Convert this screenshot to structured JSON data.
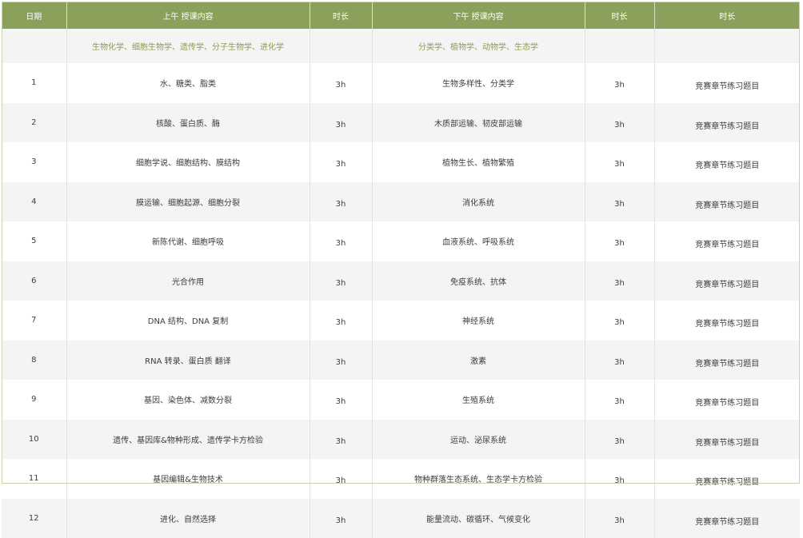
{
  "header": [
    "日期",
    "上午 授课内容",
    "时长",
    "下午 授课内容",
    "时长",
    "时长"
  ],
  "subjects": {
    "date": "",
    "morning": "生物化学、细胞生物学、遗传学、分子生物学、进化学",
    "morning_dur": "",
    "afternoon": "分类学、植物学、动物学、生态学",
    "afternoon_dur": "",
    "extra": ""
  },
  "rows": [
    {
      "date": "1",
      "morning": "水、糖类、脂类",
      "morning_dur": "3h",
      "afternoon": "生物多样性、分类学",
      "afternoon_dur": "3h",
      "extra": "竞赛章节练习题目"
    },
    {
      "date": "2",
      "morning": "核酸、蛋白质、酶",
      "morning_dur": "3h",
      "afternoon": "木质部运输、韧皮部运输",
      "afternoon_dur": "3h",
      "extra": "竞赛章节练习题目"
    },
    {
      "date": "3",
      "morning": "细胞学说、细胞结构、膜结构",
      "morning_dur": "3h",
      "afternoon": "植物生长、植物繁殖",
      "afternoon_dur": "3h",
      "extra": "竞赛章节练习题目"
    },
    {
      "date": "4",
      "morning": "膜运输、细胞起源、细胞分裂",
      "morning_dur": "3h",
      "afternoon": "消化系统",
      "afternoon_dur": "3h",
      "extra": "竞赛章节练习题目"
    },
    {
      "date": "5",
      "morning": "新陈代谢、细胞呼吸",
      "morning_dur": "3h",
      "afternoon": "血液系统、呼吸系统",
      "afternoon_dur": "3h",
      "extra": "竞赛章节练习题目"
    },
    {
      "date": "6",
      "morning": "光合作用",
      "morning_dur": "3h",
      "afternoon": "免疫系统、抗体",
      "afternoon_dur": "3h",
      "extra": "竞赛章节练习题目"
    },
    {
      "date": "7",
      "morning": "DNA 结构、DNA 复制",
      "morning_dur": "3h",
      "afternoon": "神经系统",
      "afternoon_dur": "3h",
      "extra": "竞赛章节练习题目"
    },
    {
      "date": "8",
      "morning": "RNA 转录、蛋白质 翻译",
      "morning_dur": "3h",
      "afternoon": "激素",
      "afternoon_dur": "3h",
      "extra": "竞赛章节练习题目"
    },
    {
      "date": "9",
      "morning": "基因、染色体、减数分裂",
      "morning_dur": "3h",
      "afternoon": "生殖系统",
      "afternoon_dur": "3h",
      "extra": "竞赛章节练习题目"
    },
    {
      "date": "10",
      "morning": "遗传、基因库&物种形成、遗传学卡方检验",
      "morning_dur": "3h",
      "afternoon": "运动、泌尿系统",
      "afternoon_dur": "3h",
      "extra": "竞赛章节练习题目"
    },
    {
      "date": "11",
      "morning": "基因编辑&生物技术",
      "morning_dur": "3h",
      "afternoon": "物种群落生态系统、生态学卡方检验",
      "afternoon_dur": "3h",
      "extra": "竞赛章节练习题目"
    },
    {
      "date": "12",
      "morning": "进化、自然选择",
      "morning_dur": "3h",
      "afternoon": "能量流动、碳循环、气候变化",
      "afternoon_dur": "3h",
      "extra": "竞赛章节练习题目"
    }
  ]
}
